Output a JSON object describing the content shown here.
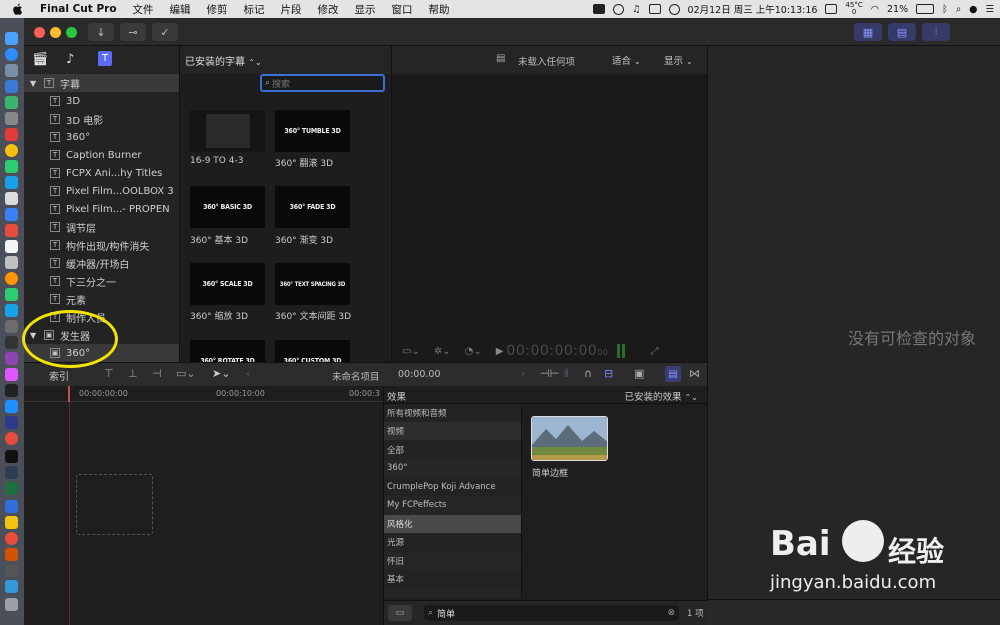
{
  "menubar": {
    "app": "Final Cut Pro",
    "items": [
      "文件",
      "编辑",
      "修剪",
      "标记",
      "片段",
      "修改",
      "显示",
      "窗口",
      "帮助"
    ],
    "temp": "45°C",
    "temp2": "0",
    "battery": "21%",
    "datetime": "02月12日 周三 上午10:13:16"
  },
  "library": {
    "sections": [
      {
        "label": "字幕",
        "items": [
          "3D",
          "3D 电影",
          "360°",
          "Caption Burner",
          "FCPX Ani...hy Titles",
          "Pixel Film...OOLBOX 3",
          "Pixel Film...- PROPEN",
          "调节层",
          "构件出现/构件消失",
          "缓冲器/开场白",
          "下三分之一",
          "元素",
          "制作人员"
        ]
      },
      {
        "label": "发生器",
        "items": [
          "360°"
        ]
      }
    ]
  },
  "browser": {
    "filter": "已安装的字幕",
    "search_placeholder": "搜索",
    "items": [
      {
        "thumb": "",
        "label": "16-9 TO 4-3"
      },
      {
        "thumb": "360° TUMBLE 3D",
        "label": "360° 翻滚 3D"
      },
      {
        "thumb": "360° BASIC 3D",
        "label": "360° 基本 3D"
      },
      {
        "thumb": "360° FADE 3D",
        "label": "360° 渐变 3D"
      },
      {
        "thumb": "360° SCALE 3D",
        "label": "360° 缩放 3D"
      },
      {
        "thumb": "360° TEXT SPACING 3D",
        "label": "360° 文本间距 3D"
      },
      {
        "thumb": "360° ROTATE 3D",
        "label": ""
      },
      {
        "thumb": "360° CUSTOM 3D",
        "label": ""
      }
    ]
  },
  "viewer": {
    "status": "未载入任何项",
    "fit": "适合",
    "display": "显示",
    "timecode": "00:00:00:00",
    "timecode_frames": "00"
  },
  "inspector": {
    "empty": "没有可检查的对象"
  },
  "timeline": {
    "index": "索引",
    "project": "未命名项目",
    "duration": "00:00.00",
    "ruler": [
      "00:00:00:00",
      "00:00:10:00",
      "00:00:3"
    ]
  },
  "effects": {
    "title": "效果",
    "installed": "已安装的效果",
    "categories": [
      "所有视频和音频",
      "视频",
      "全部",
      "360°",
      "CrumplePop Koji Advance",
      "My FCPeffects",
      "风格化",
      "光源",
      "怀旧",
      "基本",
      "..."
    ],
    "selected_index": 6,
    "result_label": "简单边框",
    "search_value": "简单",
    "count": "1 项"
  },
  "watermark": {
    "brand": "Bai",
    "brand2": "经验",
    "url": "jingyan.baidu.com"
  },
  "colors": {
    "accent": "#7c86ff",
    "highlight": "#f2e300",
    "selection": "#3a3a3a"
  }
}
